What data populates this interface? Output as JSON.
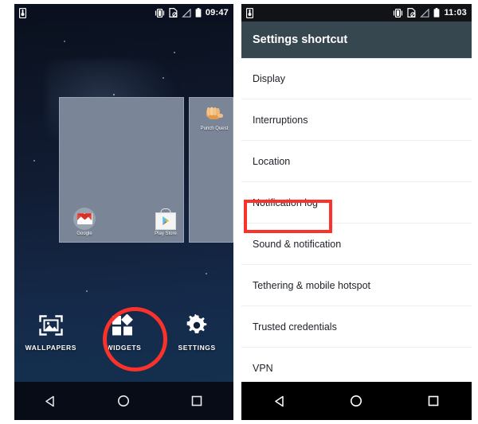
{
  "left_phone": {
    "status_bar": {
      "time": "09:47",
      "icons": [
        "sim-card-icon",
        "vibrate-icon",
        "screenshot-icon",
        "signal-triangle-icon",
        "battery-icon"
      ]
    },
    "widget_picker": {
      "cards": [
        {
          "name": "main-widget-preview",
          "apps": [
            {
              "label": "Google",
              "icon": "gmail-icon"
            },
            {
              "label": "Play Store",
              "icon": "play-store-icon"
            }
          ]
        },
        {
          "name": "side-widget-preview",
          "apps": [
            {
              "label": "Punch Quest",
              "icon": "fist-icon"
            }
          ]
        }
      ]
    },
    "options": [
      {
        "label": "WALLPAPERS",
        "icon": "wallpaper-icon",
        "highlighted": false
      },
      {
        "label": "WIDGETS",
        "icon": "widgets-icon",
        "highlighted": true
      },
      {
        "label": "SETTINGS",
        "icon": "gear-icon",
        "highlighted": false
      }
    ],
    "nav_bar": {
      "buttons": [
        {
          "name": "back",
          "icon": "back-triangle-icon"
        },
        {
          "name": "home",
          "icon": "home-circle-icon"
        },
        {
          "name": "recents",
          "icon": "recents-square-icon"
        }
      ]
    }
  },
  "right_phone": {
    "status_bar": {
      "time": "11:03",
      "icons": [
        "sim-card-icon",
        "vibrate-icon",
        "screenshot-icon",
        "signal-triangle-icon",
        "battery-icon"
      ]
    },
    "app_bar": {
      "title": "Settings shortcut"
    },
    "list_items": [
      {
        "label": "Display",
        "highlighted": false
      },
      {
        "label": "Interruptions",
        "highlighted": false
      },
      {
        "label": "Location",
        "highlighted": false
      },
      {
        "label": "Notification log",
        "highlighted": true
      },
      {
        "label": "Sound & notification",
        "highlighted": false
      },
      {
        "label": "Tethering & mobile hotspot",
        "highlighted": false
      },
      {
        "label": "Trusted credentials",
        "highlighted": false
      },
      {
        "label": "VPN",
        "highlighted": false
      }
    ],
    "nav_bar": {
      "buttons": [
        {
          "name": "back",
          "icon": "back-triangle-icon"
        },
        {
          "name": "home",
          "icon": "home-circle-icon"
        },
        {
          "name": "recents",
          "icon": "recents-square-icon"
        }
      ]
    }
  },
  "annotations": {
    "color": "#f9322c",
    "circle_target": "WIDGETS",
    "rect_target": "Notification log"
  }
}
